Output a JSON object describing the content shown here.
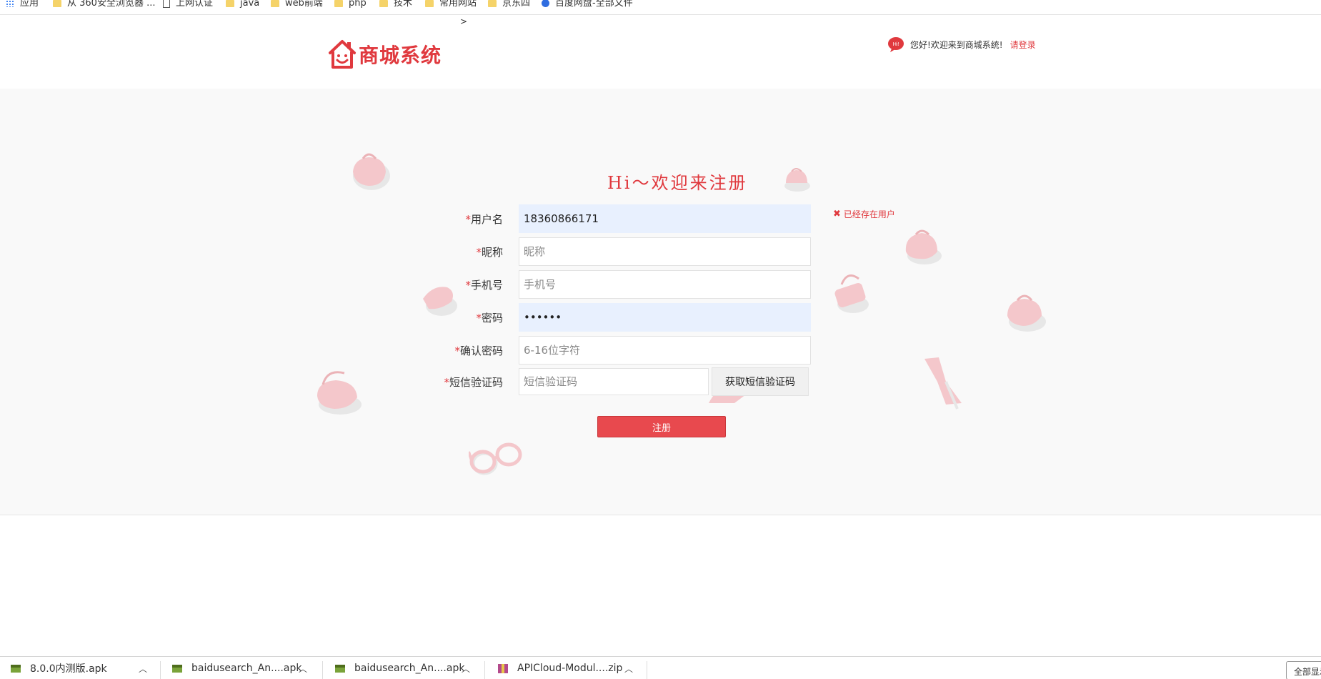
{
  "bookmarks": [
    {
      "label": "应用",
      "icon": "apps-icon"
    },
    {
      "label": "从 360安全浏览器 ...",
      "icon": "folder-icon"
    },
    {
      "label": "上网认证",
      "icon": "page-icon"
    },
    {
      "label": "java",
      "icon": "folder-icon"
    },
    {
      "label": "web前端",
      "icon": "folder-icon"
    },
    {
      "label": "php",
      "icon": "folder-icon"
    },
    {
      "label": "技术",
      "icon": "folder-icon"
    },
    {
      "label": "常用网站",
      "icon": "folder-icon"
    },
    {
      "label": "京东四",
      "icon": "folder-icon"
    },
    {
      "label": "百度网盘-全部文件",
      "icon": "baidu-icon"
    }
  ],
  "header": {
    "crumb": ">",
    "logo_text": "商城系统",
    "welcome": "您好!欢迎来到商城系统!",
    "login_link": "请登录",
    "bubble_text": "Hi!"
  },
  "form": {
    "title": "Hi～欢迎来注册",
    "required_mark": "*",
    "fields": {
      "username": {
        "label": "用户名",
        "value": "18360866171",
        "placeholder": ""
      },
      "nickname": {
        "label": "昵称",
        "value": "",
        "placeholder": "昵称"
      },
      "phone": {
        "label": "手机号",
        "value": "",
        "placeholder": "手机号"
      },
      "password": {
        "label": "密码",
        "value": "123456",
        "placeholder": ""
      },
      "confirm": {
        "label": "确认密码",
        "value": "",
        "placeholder": "6-16位字符"
      },
      "sms": {
        "label": "短信验证码",
        "value": "",
        "placeholder": "短信验证码"
      }
    },
    "sms_button": "获取短信验证码",
    "error": "已经存在用户",
    "error_mark": "✖",
    "submit": "注册"
  },
  "downloads": [
    {
      "name": "8.0.0内测版.apk",
      "icon": "apk-icon"
    },
    {
      "name": "baidusearch_An....apk",
      "icon": "apk-icon"
    },
    {
      "name": "baidusearch_An....apk",
      "icon": "apk-icon"
    },
    {
      "name": "APICloud-Modul....zip",
      "icon": "zip-icon"
    }
  ],
  "downloads_show_all": "全部显示",
  "colors": {
    "brand": "#e0393e",
    "button": "#e8494e",
    "autofill": "#e8f0fe"
  }
}
